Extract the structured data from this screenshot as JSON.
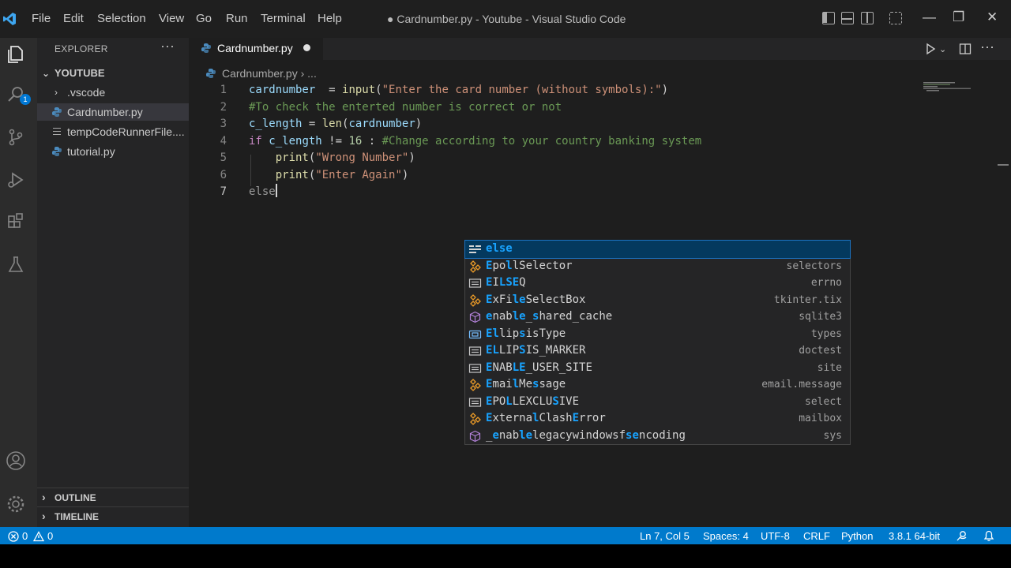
{
  "titlebar": {
    "menu": [
      "File",
      "Edit",
      "Selection",
      "View",
      "Go",
      "Run",
      "Terminal",
      "Help"
    ],
    "title": "● Cardnumber.py - Youtube - Visual Studio Code",
    "window_controls": {
      "minimize": "—",
      "restore": "❐",
      "close": "✕"
    }
  },
  "activitybar": {
    "badge": "1",
    "icons": [
      "files-icon",
      "search-icon",
      "source-control-icon",
      "run-debug-icon",
      "extensions-icon",
      "testing-icon",
      "account-icon",
      "gear-icon"
    ]
  },
  "sidebar": {
    "title": "EXPLORER",
    "more": "···",
    "folder": "YOUTUBE",
    "items": [
      {
        "label": ".vscode",
        "type": "folder"
      },
      {
        "label": "Cardnumber.py",
        "type": "python",
        "selected": true
      },
      {
        "label": "tempCodeRunnerFile....",
        "type": "text"
      },
      {
        "label": "tutorial.py",
        "type": "python"
      }
    ],
    "outline": "OUTLINE",
    "timeline": "TIMELINE"
  },
  "editor": {
    "tab": {
      "label": "Cardnumber.py",
      "modified": true
    },
    "breadcrumb": "Cardnumber.py › ...",
    "current_line": 7,
    "lines": [
      {
        "n": "1",
        "parts": [
          {
            "t": "cardnumber",
            "c": "var"
          },
          {
            "t": "  = ",
            "c": ""
          },
          {
            "t": "input",
            "c": "fn"
          },
          {
            "t": "(",
            "c": ""
          },
          {
            "t": "\"Enter the card number (without symbols):\"",
            "c": "str"
          },
          {
            "t": ")",
            "c": ""
          }
        ]
      },
      {
        "n": "2",
        "parts": [
          {
            "t": "#To check the enterted number is correct or not",
            "c": "cm"
          }
        ]
      },
      {
        "n": "3",
        "parts": [
          {
            "t": "c_length",
            "c": "var"
          },
          {
            "t": " = ",
            "c": ""
          },
          {
            "t": "len",
            "c": "fn"
          },
          {
            "t": "(",
            "c": ""
          },
          {
            "t": "cardnumber",
            "c": "var"
          },
          {
            "t": ")",
            "c": ""
          }
        ]
      },
      {
        "n": "4",
        "parts": [
          {
            "t": "if",
            "c": "kw"
          },
          {
            "t": " ",
            "c": ""
          },
          {
            "t": "c_length",
            "c": "var"
          },
          {
            "t": " != ",
            "c": ""
          },
          {
            "t": "16",
            "c": "num"
          },
          {
            "t": " : ",
            "c": ""
          },
          {
            "t": "#Change according to your country banking system",
            "c": "cm"
          }
        ]
      },
      {
        "n": "5",
        "parts": [
          {
            "t": "    ",
            "c": ""
          },
          {
            "t": "print",
            "c": "fn"
          },
          {
            "t": "(",
            "c": ""
          },
          {
            "t": "\"Wrong Number\"",
            "c": "str"
          },
          {
            "t": ")",
            "c": ""
          }
        ]
      },
      {
        "n": "6",
        "parts": [
          {
            "t": "    ",
            "c": ""
          },
          {
            "t": "print",
            "c": "fn"
          },
          {
            "t": "(",
            "c": ""
          },
          {
            "t": "\"Enter Again\"",
            "c": "str"
          },
          {
            "t": ")",
            "c": ""
          }
        ]
      },
      {
        "n": "7",
        "parts": [
          {
            "t": "else",
            "c": "kw-dim"
          }
        ]
      }
    ]
  },
  "suggestions": [
    {
      "icon": "keyword",
      "parts": [
        [
          "else",
          true
        ]
      ],
      "detail": ""
    },
    {
      "icon": "class",
      "parts": [
        [
          "E",
          true
        ],
        [
          "po",
          false
        ],
        [
          "l",
          true
        ],
        [
          "lSelector",
          false
        ]
      ],
      "detail": "selectors"
    },
    {
      "icon": "constant",
      "parts": [
        [
          "E",
          true
        ],
        [
          "I",
          false
        ],
        [
          "L",
          true
        ],
        [
          "SE",
          true
        ],
        [
          "Q",
          false
        ]
      ],
      "detail": "errno"
    },
    {
      "icon": "class",
      "parts": [
        [
          "E",
          true
        ],
        [
          "xFi",
          false
        ],
        [
          "l",
          true
        ],
        [
          "e",
          true
        ],
        [
          "SelectBox",
          false
        ]
      ],
      "detail": "tkinter.tix"
    },
    {
      "icon": "method",
      "parts": [
        [
          "e",
          true
        ],
        [
          "nab",
          false
        ],
        [
          "le",
          true
        ],
        [
          "_",
          false
        ],
        [
          "s",
          true
        ],
        [
          "hared_cache",
          false
        ]
      ],
      "detail": "sqlite3"
    },
    {
      "icon": "variable",
      "parts": [
        [
          "E",
          true
        ],
        [
          "l",
          true
        ],
        [
          "lip",
          false
        ],
        [
          "s",
          true
        ],
        [
          "isType",
          false
        ]
      ],
      "detail": "types"
    },
    {
      "icon": "constant",
      "parts": [
        [
          "E",
          true
        ],
        [
          "L",
          true
        ],
        [
          "LIP",
          false
        ],
        [
          "S",
          true
        ],
        [
          "IS_MARKER",
          false
        ]
      ],
      "detail": "doctest"
    },
    {
      "icon": "constant",
      "parts": [
        [
          "E",
          true
        ],
        [
          "NAB",
          false
        ],
        [
          "L",
          true
        ],
        [
          "E",
          true
        ],
        [
          "_USER_SITE",
          false
        ]
      ],
      "detail": "site"
    },
    {
      "icon": "class",
      "parts": [
        [
          "E",
          true
        ],
        [
          "mai",
          false
        ],
        [
          "l",
          true
        ],
        [
          "Me",
          false
        ],
        [
          "s",
          true
        ],
        [
          "sage",
          false
        ]
      ],
      "detail": "email.message"
    },
    {
      "icon": "constant",
      "parts": [
        [
          "E",
          true
        ],
        [
          "PO",
          false
        ],
        [
          "L",
          true
        ],
        [
          "LEXCLU",
          false
        ],
        [
          "S",
          true
        ],
        [
          "IVE",
          false
        ]
      ],
      "detail": "select"
    },
    {
      "icon": "class",
      "parts": [
        [
          "E",
          true
        ],
        [
          "xterna",
          false
        ],
        [
          "l",
          true
        ],
        [
          "Clash",
          false
        ],
        [
          "E",
          true
        ],
        [
          "rror",
          false
        ]
      ],
      "detail": "mailbox"
    },
    {
      "icon": "method",
      "parts": [
        [
          "_",
          false
        ],
        [
          "e",
          true
        ],
        [
          "nab",
          false
        ],
        [
          "le",
          true
        ],
        [
          "legacywindowsf",
          false
        ],
        [
          "se",
          true
        ],
        [
          "ncoding",
          false
        ]
      ],
      "detail": "sys"
    }
  ],
  "statusbar": {
    "errors": "0",
    "warnings": "0",
    "position": "Ln 7, Col 5",
    "spaces": "Spaces: 4",
    "encoding": "UTF-8",
    "eol": "CRLF",
    "language": "Python",
    "interpreter": "3.8.1 64-bit"
  },
  "colors": {
    "statusbar": "#007acc",
    "accent": "#0078d4",
    "match": "#18a3ff"
  }
}
